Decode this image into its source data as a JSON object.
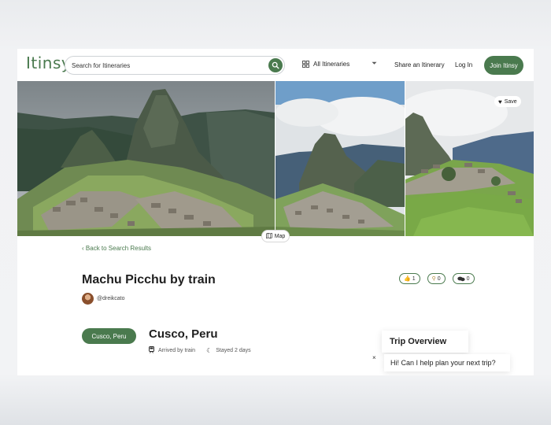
{
  "header": {
    "logo": "Itinsy",
    "search_placeholder": "Search for Itineraries",
    "filter_label": "All Itineraries",
    "share_label": "Share an Itinerary",
    "login_label": "Log In",
    "join_label": "Join Itinsy"
  },
  "gallery": {
    "save_label": "Save",
    "map_label": "Map"
  },
  "trip": {
    "back_label": "Back to Search Results",
    "title": "Machu Picchu by train",
    "author": "@dreikcato",
    "reactions": [
      {
        "icon": "thumbs-up-icon",
        "count": "1"
      },
      {
        "icon": "pin-icon",
        "count": "0"
      },
      {
        "icon": "comments-icon",
        "count": "0"
      }
    ]
  },
  "stop": {
    "badge": "Cusco, Peru",
    "title": "Cusco, Peru",
    "arrived": "Arrived by train",
    "stayed": "Stayed 2 days"
  },
  "chat": {
    "overview_title": "Trip Overview",
    "message": "Hi! Can I help plan your next trip?",
    "close": "×"
  },
  "colors": {
    "brand_green": "#4a7a4e"
  }
}
